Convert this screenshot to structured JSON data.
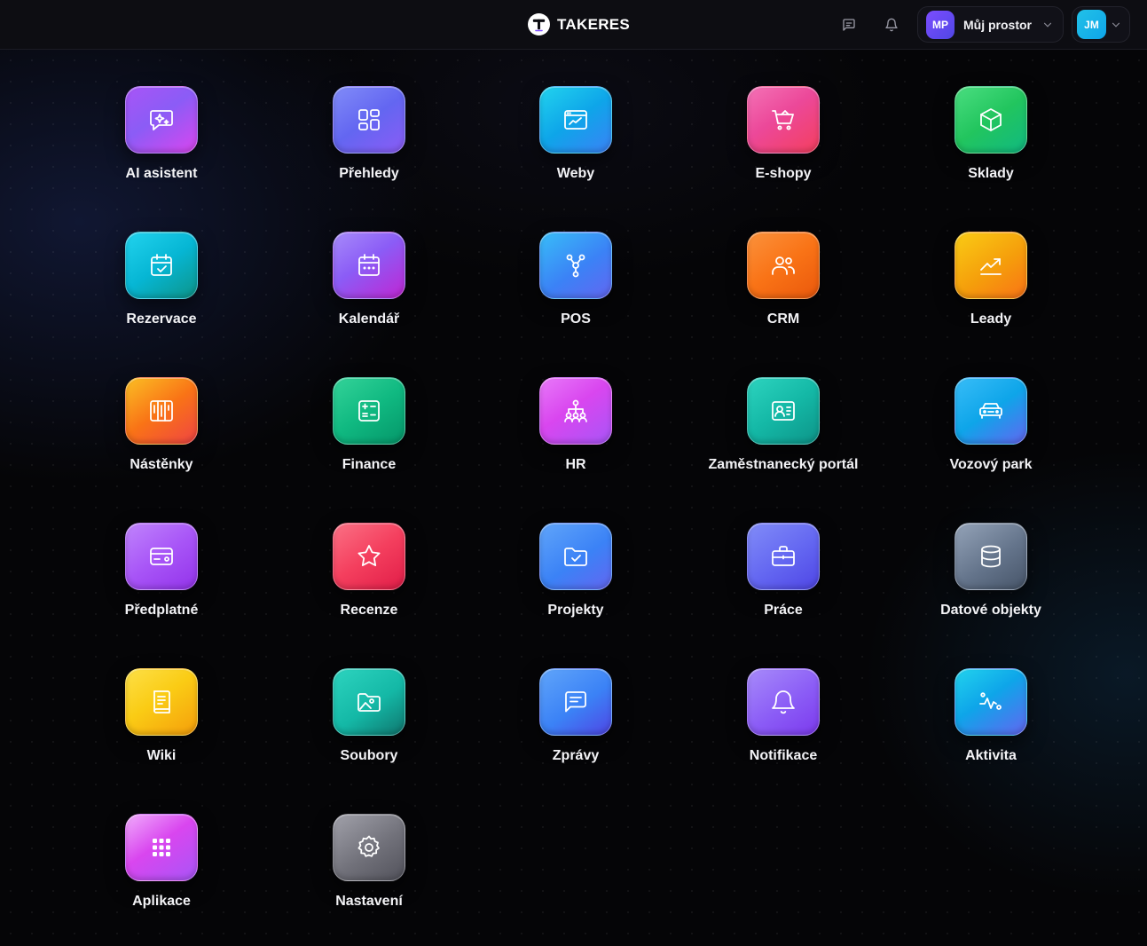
{
  "header": {
    "brand": "TAKERES",
    "messages_icon": "message-square-icon",
    "notifications_icon": "bell-icon",
    "workspace": {
      "initials": "MP",
      "name": "Můj prostor"
    },
    "user": {
      "initials": "JM"
    }
  },
  "apps": [
    {
      "label": "AI asistent",
      "icon": "ai-sparkle-chat-icon",
      "color": "#a855f7"
    },
    {
      "label": "Přehledy",
      "icon": "dashboard-grid-icon",
      "color": "#6366f1"
    },
    {
      "label": "Weby",
      "icon": "browser-chart-icon",
      "color": "#0ea5e9"
    },
    {
      "label": "E-shopy",
      "icon": "shopping-cart-icon",
      "color": "#ec4899"
    },
    {
      "label": "Sklady",
      "icon": "box-icon",
      "color": "#22c55e"
    },
    {
      "label": "Rezervace",
      "icon": "calendar-check-icon",
      "color": "#06b6d4"
    },
    {
      "label": "Kalendář",
      "icon": "calendar-icon",
      "color": "#8b5cf6"
    },
    {
      "label": "POS",
      "icon": "nodes-icon",
      "color": "#3b82f6"
    },
    {
      "label": "CRM",
      "icon": "users-icon",
      "color": "#f97316"
    },
    {
      "label": "Leady",
      "icon": "trending-up-icon",
      "color": "#f59e0b"
    },
    {
      "label": "Nástěnky",
      "icon": "kanban-icon",
      "color": "#f97316"
    },
    {
      "label": "Finance",
      "icon": "calculator-icon",
      "color": "#10b981"
    },
    {
      "label": "HR",
      "icon": "org-chart-icon",
      "color": "#d946ef"
    },
    {
      "label": "Zaměstnanecký portál",
      "icon": "id-card-icon",
      "color": "#14b8a6"
    },
    {
      "label": "Vozový park",
      "icon": "car-icon",
      "color": "#0ea5e9"
    },
    {
      "label": "Předplatné",
      "icon": "credit-card-icon",
      "color": "#a855f7"
    },
    {
      "label": "Recenze",
      "icon": "star-icon",
      "color": "#f43f5e"
    },
    {
      "label": "Projekty",
      "icon": "folder-check-icon",
      "color": "#3b82f6"
    },
    {
      "label": "Práce",
      "icon": "briefcase-icon",
      "color": "#6366f1"
    },
    {
      "label": "Datové objekty",
      "icon": "database-icon",
      "color": "#64748b"
    },
    {
      "label": "Wiki",
      "icon": "book-icon",
      "color": "#facc15"
    },
    {
      "label": "Soubory",
      "icon": "folder-image-icon",
      "color": "#14b8a6"
    },
    {
      "label": "Zprávy",
      "icon": "message-square-icon",
      "color": "#3b82f6"
    },
    {
      "label": "Notifikace",
      "icon": "bell-icon",
      "color": "#8b5cf6"
    },
    {
      "label": "Aktivita",
      "icon": "activity-icon",
      "color": "#0ea5e9"
    },
    {
      "label": "Aplikace",
      "icon": "apps-grid-icon",
      "color": "#d946ef"
    },
    {
      "label": "Nastavení",
      "icon": "gear-icon",
      "color": "#71717a"
    }
  ]
}
